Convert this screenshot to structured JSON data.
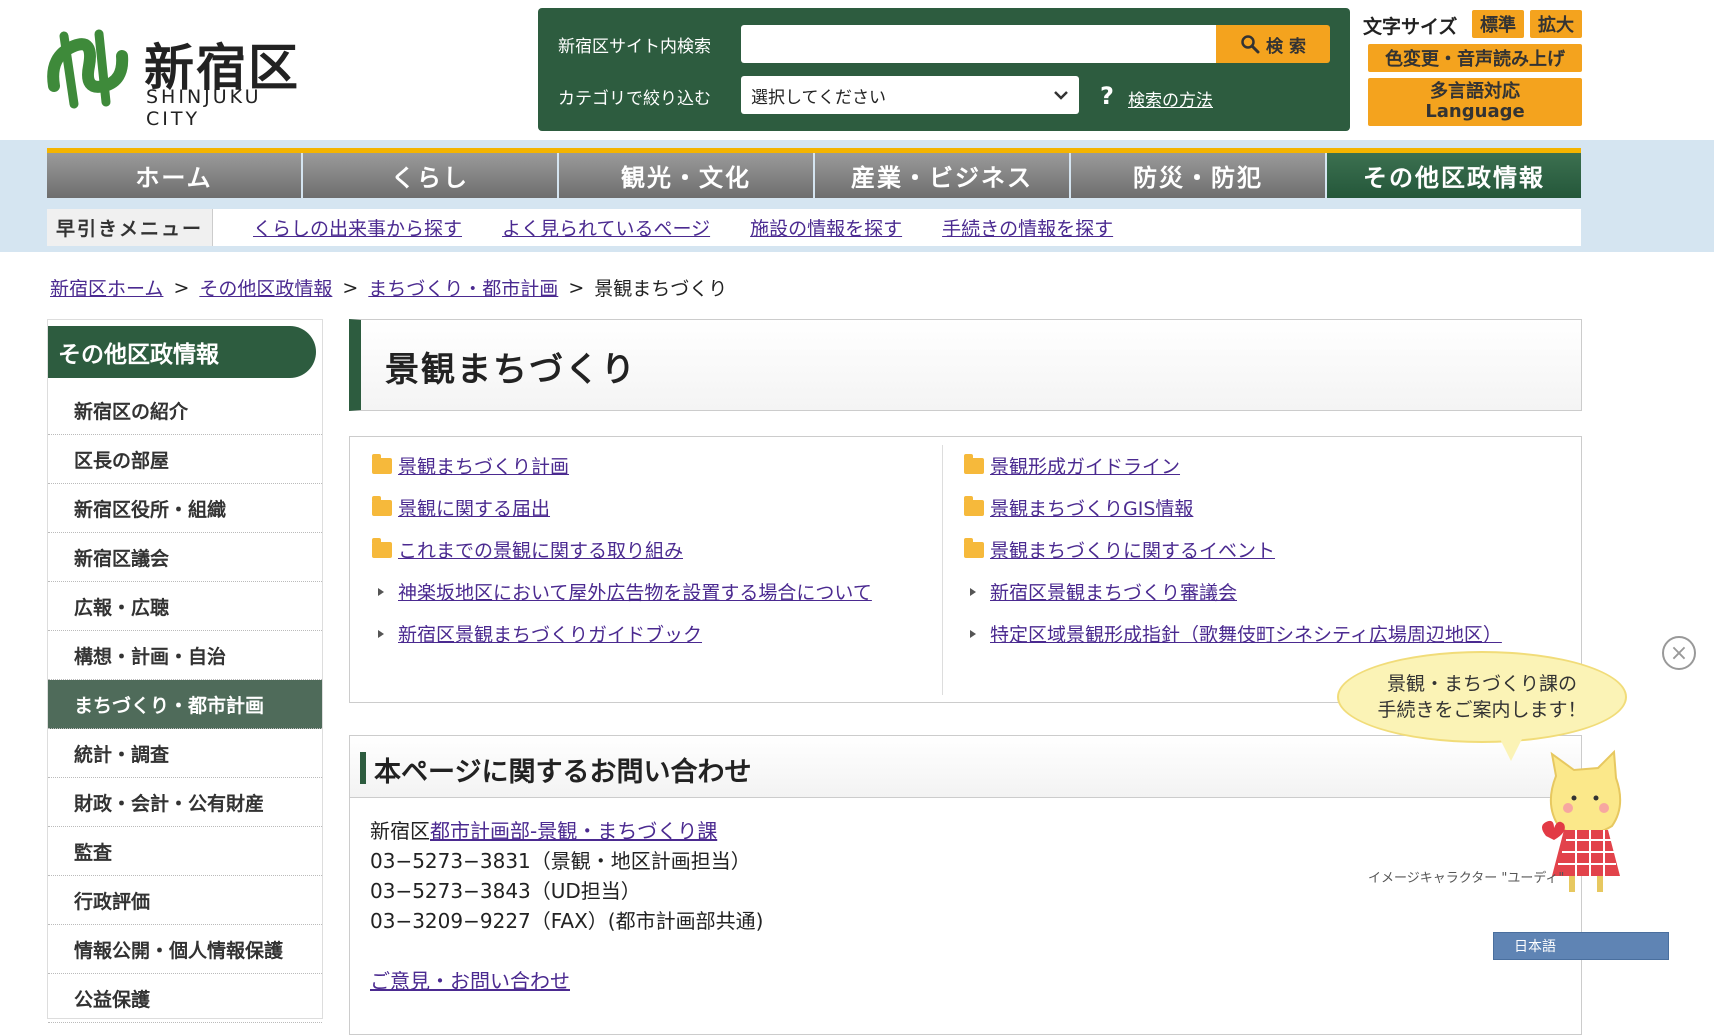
{
  "header": {
    "logo_ja": "新宿区",
    "logo_en": "SHINJUKU CITY",
    "search_label": "新宿区サイト内検索",
    "search_value": "",
    "search_button": "検 索",
    "category_label": "カテゴリで絞り込む",
    "category_selected": "選択してください",
    "help_link": "検索の方法",
    "font_size_label": "文字サイズ",
    "font_size_normal": "標準",
    "font_size_large": "拡大",
    "color_voice": "色変更・音声読み上げ",
    "multilang_1": "多言語対応",
    "multilang_2": "Language"
  },
  "nav": {
    "items": [
      "ホーム",
      "くらし",
      "観光・文化",
      "産業・ビジネス",
      "防災・防犯",
      "その他区政情報"
    ]
  },
  "quick_menu": {
    "title": "早引きメニュー",
    "links": [
      "くらしの出来事から探す",
      "よく見られているページ",
      "施設の情報を探す",
      "手続きの情報を探す"
    ]
  },
  "breadcrumb": {
    "items": [
      "新宿区ホーム",
      "その他区政情報",
      "まちづくり・都市計画"
    ],
    "current": "景観まちづくり",
    "separator": ">"
  },
  "sidebar": {
    "title": "その他区政情報",
    "items": [
      "新宿区の紹介",
      "区長の部屋",
      "新宿区役所・組織",
      "新宿区議会",
      "広報・広聴",
      "構想・計画・自治",
      "まちづくり・都市計画",
      "統計・調査",
      "財政・会計・公有財産",
      "監査",
      "行政評価",
      "情報公開・個人情報保護",
      "公益保護"
    ],
    "active_index": 6
  },
  "page": {
    "title": "景観まちづくり"
  },
  "links": {
    "left": [
      {
        "icon": "folder-icon",
        "text": "景観まちづくり計画"
      },
      {
        "icon": "folder-icon",
        "text": "景観に関する届出"
      },
      {
        "icon": "folder-icon",
        "text": "これまでの景観に関する取り組み"
      },
      {
        "icon": "bullet-icon",
        "text": "神楽坂地区において屋外広告物を設置する場合について"
      },
      {
        "icon": "bullet-icon",
        "text": "新宿区景観まちづくりガイドブック"
      }
    ],
    "right": [
      {
        "icon": "folder-icon",
        "text": "景観形成ガイドライン"
      },
      {
        "icon": "folder-icon",
        "text": "景観まちづくりGIS情報"
      },
      {
        "icon": "folder-icon",
        "text": "景観まちづくりに関するイベント"
      },
      {
        "icon": "bullet-icon",
        "text": "新宿区景観まちづくり審議会"
      },
      {
        "icon": "bullet-icon",
        "text": "特定区域景観形成指針（歌舞伎町シネシティ広場周辺地区）"
      }
    ]
  },
  "contact": {
    "heading": "本ページに関するお問い合わせ",
    "prefix": "新宿区",
    "dept_link": "都市計画部-景観・まちづくり課",
    "lines": [
      "03−5273−3831（景観・地区計画担当）",
      "03−5273−3843（UD担当）",
      "03−3209−9227（FAX）(都市計画部共通)"
    ],
    "inquiry_link": "ご意見・お問い合わせ"
  },
  "assistant": {
    "bubble_line1": "景観・まちづくり課の",
    "bubble_line2": "手続きをご案内します！",
    "caption": "イメージキャラクター \"ユーディ\"",
    "language": "日本語"
  },
  "colors": {
    "brand_green": "#2d5c3f",
    "accent_orange": "#f4a31e",
    "link_purple": "#4b2a90"
  }
}
